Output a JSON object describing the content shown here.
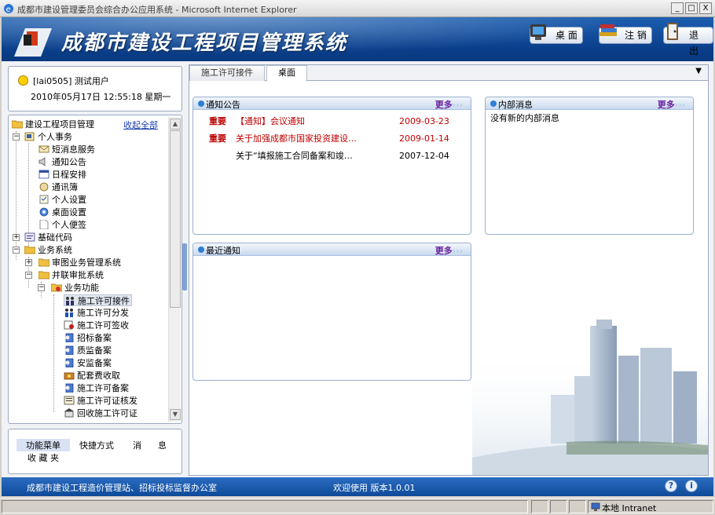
{
  "window": {
    "title": "成都市建设管理委员会综合办公应用系统 - Microsoft Internet Explorer",
    "controls": [
      "_",
      "□",
      "X"
    ]
  },
  "header": {
    "app_title": "成都市建设工程项目管理系统",
    "buttons": [
      {
        "label": "桌 面",
        "icon": "desktop-icon"
      },
      {
        "label": "注 销",
        "icon": "books-icon"
      },
      {
        "label": "退 出",
        "icon": "exit-door-icon"
      }
    ]
  },
  "user": {
    "name": "[lai0505] 测试用户",
    "datetime": "2010年05月17日  12:55:18  星期一"
  },
  "tree": {
    "collapse_all": "收起全部",
    "nodes": [
      {
        "label": "建设工程项目管理",
        "icon": "folder-open-icon"
      },
      {
        "label": "个人事务",
        "icon": "calendar-book-icon"
      },
      {
        "label": "短消息服务",
        "icon": "message-icon"
      },
      {
        "label": "通知公告",
        "icon": "speaker-icon"
      },
      {
        "label": "日程安排",
        "icon": "schedule-icon"
      },
      {
        "label": "通讯簿",
        "icon": "address-book-icon"
      },
      {
        "label": "个人设置",
        "icon": "settings-icon"
      },
      {
        "label": "桌面设置",
        "icon": "desktop-settings-icon"
      },
      {
        "label": "个人便签",
        "icon": "note-icon"
      },
      {
        "label": "基础代码",
        "icon": "code-icon"
      },
      {
        "label": "业务系统",
        "icon": "folder-open-icon"
      },
      {
        "label": "审图业务管理系统",
        "icon": "folder-icon"
      },
      {
        "label": "并联审批系统",
        "icon": "folder-open-icon"
      },
      {
        "label": "业务功能",
        "icon": "function-icon"
      },
      {
        "label": "施工许可接件",
        "icon": "people-icon"
      },
      {
        "label": "施工许可分发",
        "icon": "people-distribute-icon"
      },
      {
        "label": "施工许可签收",
        "icon": "sign-icon"
      },
      {
        "label": "招标备案",
        "icon": "file-person-icon"
      },
      {
        "label": "质监备案",
        "icon": "file-person-icon"
      },
      {
        "label": "安监备案",
        "icon": "file-person-icon"
      },
      {
        "label": "配套费收取",
        "icon": "fee-icon"
      },
      {
        "label": "施工许可备案",
        "icon": "file-person-icon"
      },
      {
        "label": "施工许可证核发",
        "icon": "certificate-icon"
      },
      {
        "label": "回收施工许可证",
        "icon": "building-icon"
      }
    ]
  },
  "bottom_tabs": [
    "功能菜单",
    "快捷方式",
    "消",
    "息",
    "收 藏 夹"
  ],
  "tabs": [
    {
      "label": "施工许可接件",
      "active": false
    },
    {
      "label": "桌面",
      "active": true
    }
  ],
  "tab_menu_glyph": "▼",
  "panels": {
    "notice": {
      "title": "通知公告",
      "more": "更多",
      "more_arrows": "›››",
      "rows": [
        {
          "flag": "重要",
          "title": "【通知】会议通知",
          "date": "2009-03-23",
          "highlight": true
        },
        {
          "flag": "重要",
          "title": "关于加强成都市国家投资建设…",
          "date": "2009-01-14",
          "highlight": true
        },
        {
          "flag": "",
          "title": "关于“填报施工合同备案和竣…",
          "date": "2007-12-04",
          "highlight": false
        }
      ]
    },
    "internal": {
      "title": "内部消息",
      "more": "更多",
      "more_arrows": "›››",
      "empty_text": "没有新的内部消息"
    },
    "recent": {
      "title": "最近通知",
      "more": "更多",
      "more_arrows": "›››"
    }
  },
  "statusbar": {
    "left": "成都市建设工程造价管理站、招标投标监督办公室",
    "middle": "欢迎使用 版本1.0.01",
    "help_icon": "?",
    "info_icon": "i"
  },
  "ie_status": {
    "zone": "本地 Intranet"
  },
  "colors": {
    "header_blue": "#0a3f8c",
    "important_red": "#c00000",
    "more_purple": "#6a22a0"
  }
}
